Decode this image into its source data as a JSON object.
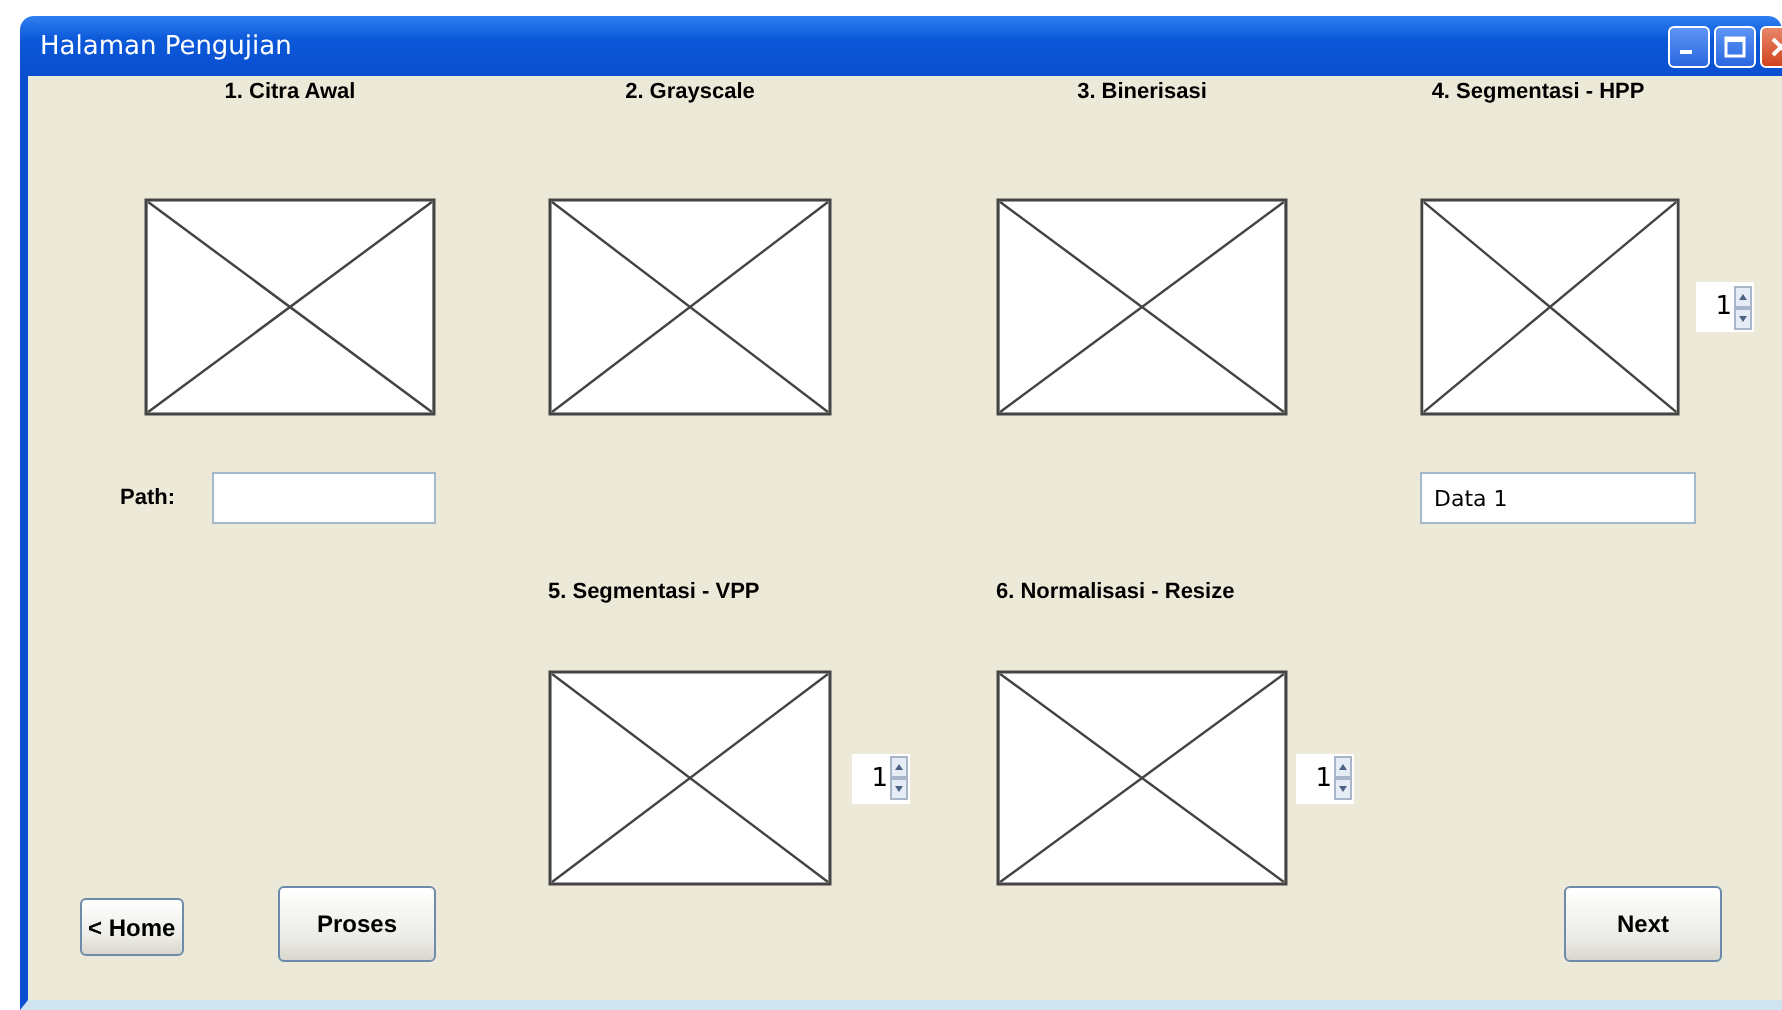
{
  "window": {
    "title": "Halaman Pengujian",
    "controls": [
      {
        "kind": "minimize"
      },
      {
        "kind": "maximize"
      },
      {
        "kind": "close"
      }
    ]
  },
  "images": [
    {
      "label": "1. Citra Awal"
    },
    {
      "label": "2. Grayscale"
    },
    {
      "label": "3. Binerisasi"
    },
    {
      "label": "4. Segmentasi - HPP",
      "spinner": "1"
    },
    {
      "label": "5. Segmentasi - VPP",
      "spinner": "1"
    },
    {
      "label": "6. Normalisasi - Resize",
      "spinner": "1"
    }
  ],
  "path_label": "Path:",
  "data_field": {
    "value": "Data 1"
  },
  "buttons": [
    {
      "label": "< Home"
    },
    {
      "label": "Proses"
    },
    {
      "label": "Next"
    }
  ]
}
